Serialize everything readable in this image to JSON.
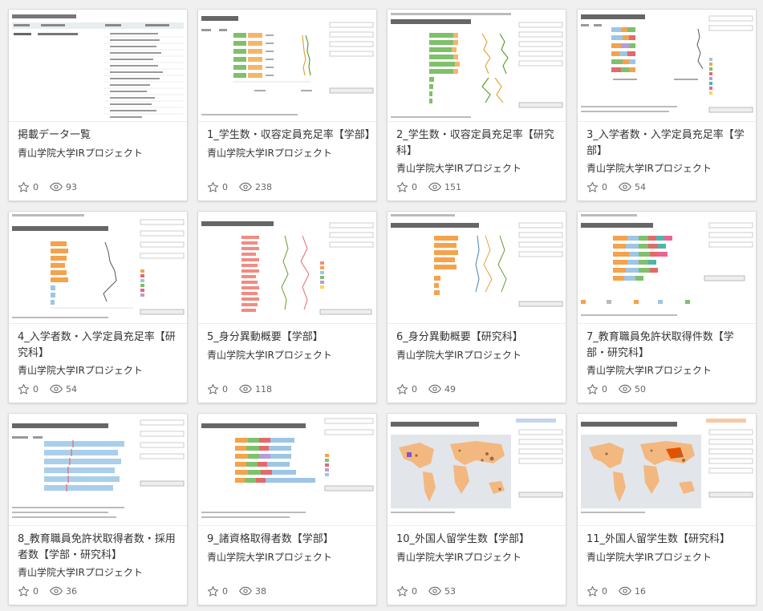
{
  "cards": [
    {
      "title": "掲載データ一覧",
      "author": "青山学院大学IRプロジェクト",
      "favorites": "0",
      "views": "93"
    },
    {
      "title": "1_学生数・収容定員充足率【学部】",
      "author": "青山学院大学IRプロジェクト",
      "favorites": "0",
      "views": "238"
    },
    {
      "title": "2_学生数・収容定員充足率【研究科】",
      "author": "青山学院大学IRプロジェクト",
      "favorites": "0",
      "views": "151"
    },
    {
      "title": "3_入学者数・入学定員充足率【学部】",
      "author": "青山学院大学IRプロジェクト",
      "favorites": "0",
      "views": "54"
    },
    {
      "title": "4_入学者数・入学定員充足率【研究科】",
      "author": "青山学院大学IRプロジェクト",
      "favorites": "0",
      "views": "54"
    },
    {
      "title": "5_身分異動概要【学部】",
      "author": "青山学院大学IRプロジェクト",
      "favorites": "0",
      "views": "118"
    },
    {
      "title": "6_身分異動概要【研究科】",
      "author": "青山学院大学IRプロジェクト",
      "favorites": "0",
      "views": "49"
    },
    {
      "title": "7_教育職員免許状取得件数【学部・研究科】",
      "author": "青山学院大学IRプロジェクト",
      "favorites": "0",
      "views": "50"
    },
    {
      "title": "8_教育職員免許状取得者数・採用者数【学部・研究科】",
      "author": "青山学院大学IRプロジェクト",
      "favorites": "0",
      "views": "36"
    },
    {
      "title": "9_諸資格取得者数【学部】",
      "author": "青山学院大学IRプロジェクト",
      "favorites": "0",
      "views": "38"
    },
    {
      "title": "10_外国人留学生数【学部】",
      "author": "青山学院大学IRプロジェクト",
      "favorites": "0",
      "views": "53"
    },
    {
      "title": "11_外国人留学生数【研究科】",
      "author": "青山学院大学IRプロジェクト",
      "favorites": "0",
      "views": "16"
    }
  ],
  "colors": {
    "accent": "#5aa02c",
    "barBlue": "#9ec5e6",
    "barOrange": "#f5a24b",
    "barGreen": "#7fc06a",
    "mapOcean": "#e2e6ea",
    "mapLand": "#f2b880"
  },
  "icons": {
    "favorite": "star-outline-icon",
    "views": "eye-icon"
  }
}
